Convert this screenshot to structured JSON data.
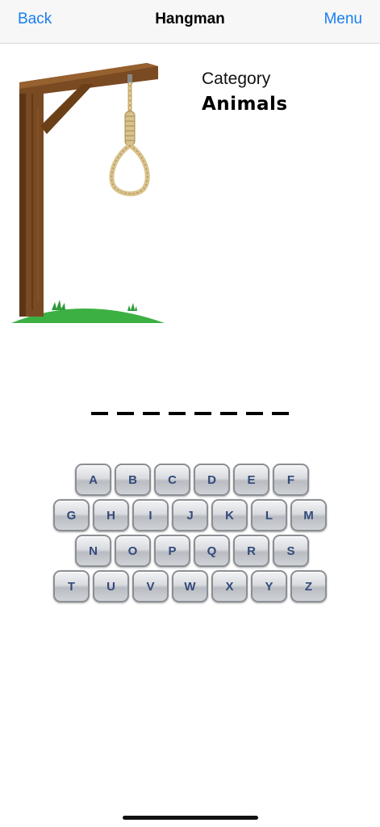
{
  "nav": {
    "back_label": "Back",
    "title": "Hangman",
    "menu_label": "Menu"
  },
  "category": {
    "label": "Category",
    "value": "Animals"
  },
  "word": {
    "length": 8
  },
  "keyboard": {
    "rows": [
      [
        "A",
        "B",
        "C",
        "D",
        "E",
        "F"
      ],
      [
        "G",
        "H",
        "I",
        "J",
        "K",
        "L",
        "M"
      ],
      [
        "N",
        "O",
        "P",
        "Q",
        "R",
        "S"
      ],
      [
        "T",
        "U",
        "V",
        "W",
        "X",
        "Y",
        "Z"
      ]
    ]
  },
  "colors": {
    "accent": "#1a7ff0",
    "key_text": "#324a7a",
    "wood": "#7a4a22",
    "grass": "#3cb043",
    "rope": "#d9c28c"
  }
}
